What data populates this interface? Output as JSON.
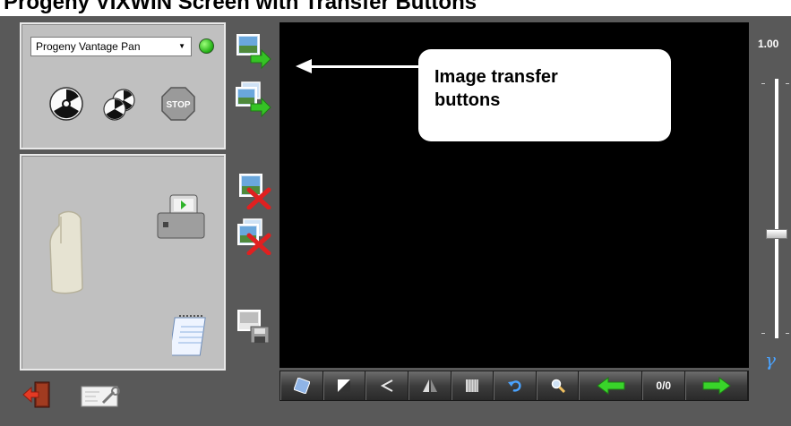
{
  "page_title": "Progeny VIXWIN Screen with Transfer Buttons",
  "acquisition": {
    "device_select_value": "Progeny Vantage Pan",
    "status_color": "#22c414"
  },
  "callout": {
    "text_line1": "Image transfer",
    "text_line2": "buttons"
  },
  "navbar": {
    "counter": "0/0"
  },
  "slider": {
    "value_label": "1.00",
    "level": 0.6
  },
  "colors": {
    "background": "#595959",
    "panel": "#c0c0c0",
    "viewer": "#000000",
    "nav_arrow": "#39d42a",
    "gamma": "#4aa3ff"
  }
}
